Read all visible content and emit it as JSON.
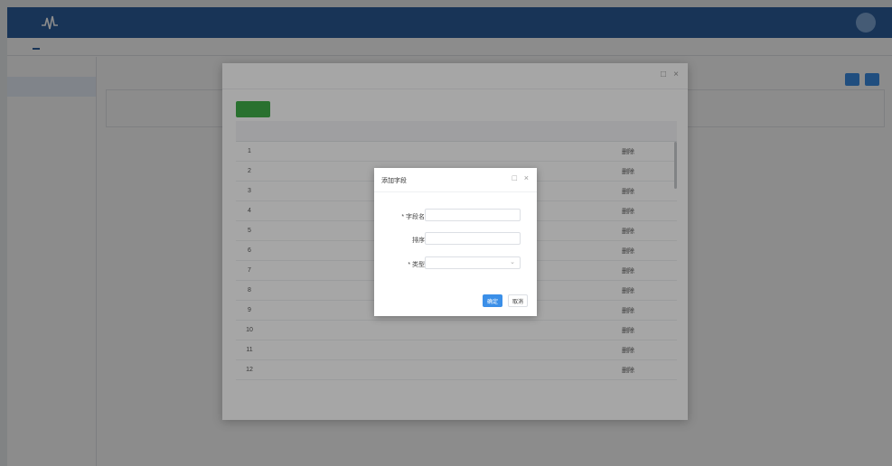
{
  "colors": {
    "topbar": "#2c5f9e",
    "primary": "#3b8fe8",
    "add": "#3fae49",
    "danger": "#e04848"
  },
  "header": {
    "logo_icon": "waveform-logo-icon"
  },
  "outer_dialog": {
    "close_icon": "close-icon",
    "maximize_icon": "maximize-icon",
    "add_icon": "add-icon",
    "rows": [
      {
        "index": "1",
        "delete": "删除"
      },
      {
        "index": "2",
        "delete": "删除"
      },
      {
        "index": "3",
        "delete": "删除"
      },
      {
        "index": "4",
        "delete": "删除"
      },
      {
        "index": "5",
        "delete": "删除"
      },
      {
        "index": "6",
        "delete": "删除"
      },
      {
        "index": "7",
        "delete": "删除"
      },
      {
        "index": "8",
        "delete": "删除"
      },
      {
        "index": "9",
        "delete": "删除"
      },
      {
        "index": "10",
        "delete": "删除"
      },
      {
        "index": "11",
        "delete": "删除"
      },
      {
        "index": "12",
        "delete": "删除"
      }
    ]
  },
  "inner_dialog": {
    "title": "添加字段",
    "close_icon": "close-icon",
    "maximize_icon": "maximize-icon",
    "fields": [
      {
        "label": "* 字段名",
        "value": ""
      },
      {
        "label": "排序",
        "value": ""
      },
      {
        "label": "* 类型",
        "value": ""
      }
    ],
    "select_caret": "chevron-down-icon",
    "confirm_label": "确定",
    "cancel_label": "取消"
  }
}
